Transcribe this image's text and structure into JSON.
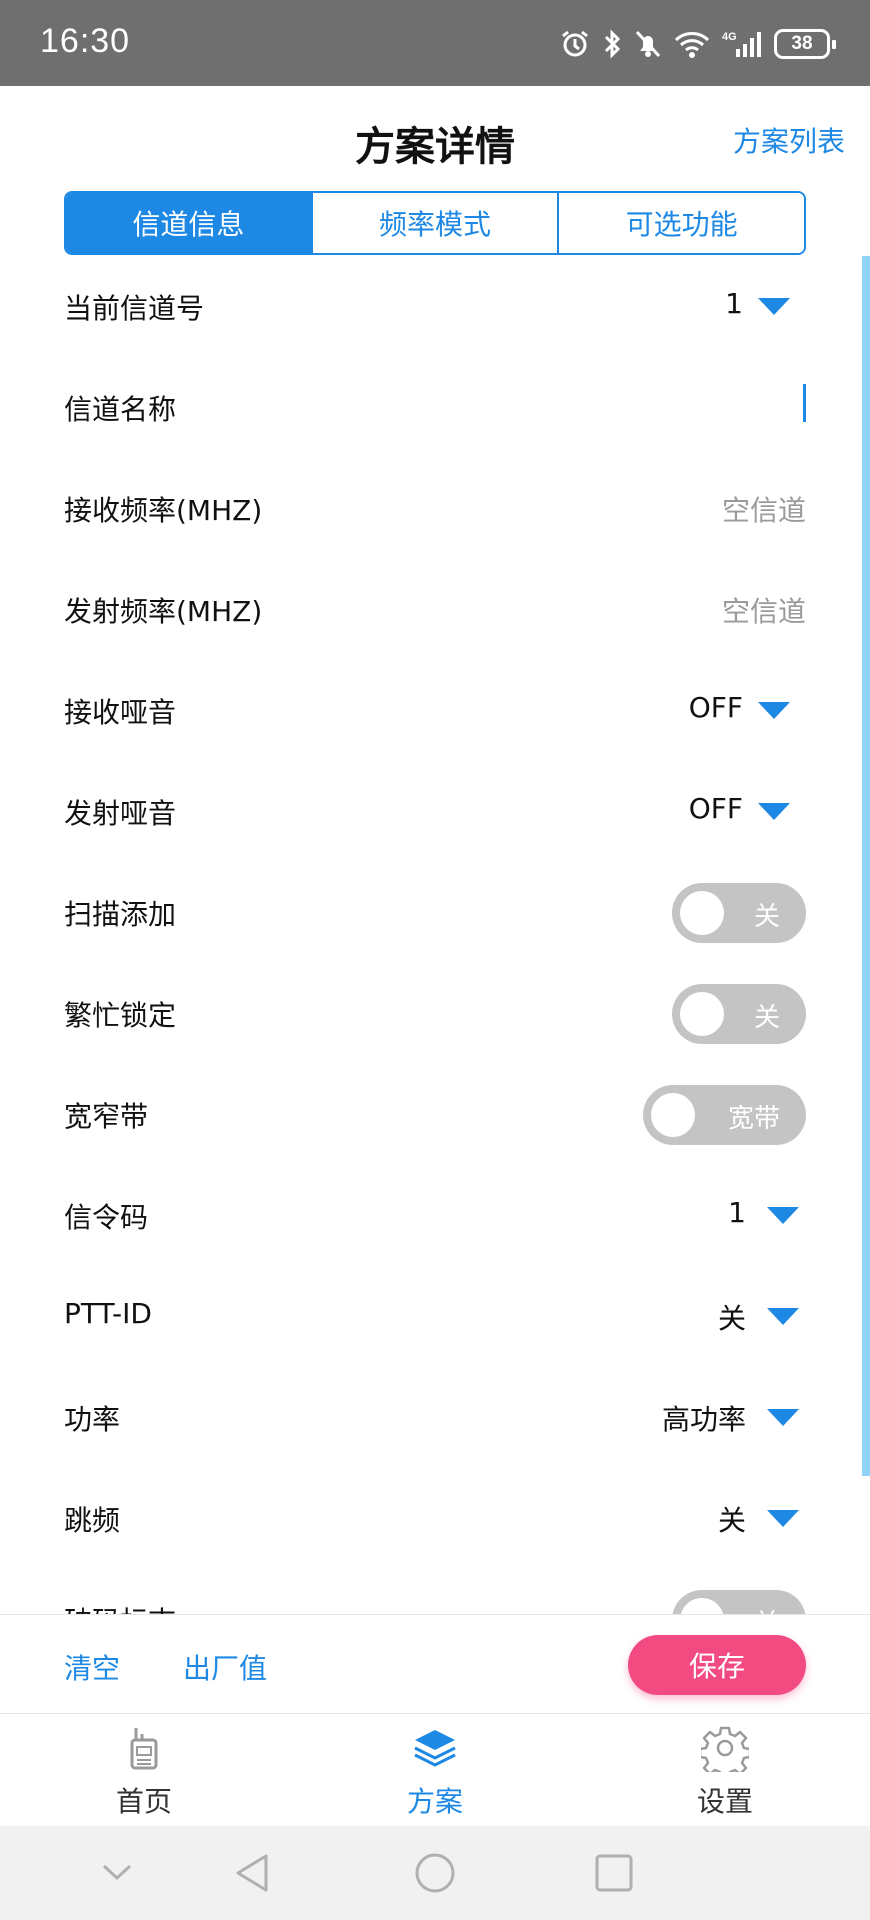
{
  "status_bar": {
    "time": "16:30",
    "battery": "38"
  },
  "header": {
    "title": "方案详情",
    "plan_list": "方案列表"
  },
  "tabs": [
    {
      "label": "信道信息",
      "active": true
    },
    {
      "label": "频率模式",
      "active": false
    },
    {
      "label": "可选功能",
      "active": false
    }
  ],
  "rows": {
    "channel_no": {
      "label": "当前信道号",
      "value": "1"
    },
    "channel_name": {
      "label": "信道名称",
      "value": ""
    },
    "rx_freq": {
      "label": "接收频率(MHZ)",
      "placeholder": "空信道"
    },
    "tx_freq": {
      "label": "发射频率(MHZ)",
      "placeholder": "空信道"
    },
    "rx_squelch": {
      "label": "接收哑音",
      "value": "OFF"
    },
    "tx_squelch": {
      "label": "发射哑音",
      "value": "OFF"
    },
    "scan_add": {
      "label": "扫描添加",
      "toggle": "关"
    },
    "busy_lock": {
      "label": "繁忙锁定",
      "toggle": "关"
    },
    "bandwidth": {
      "label": "宽窄带",
      "toggle": "宽带"
    },
    "signal_code": {
      "label": "信令码",
      "value": "1"
    },
    "ptt_id": {
      "label": "PTT-ID",
      "value": "关"
    },
    "power": {
      "label": "功率",
      "value": "高功率"
    },
    "freq_hop": {
      "label": "跳频",
      "value": "关"
    },
    "scramble": {
      "label": "破码标志",
      "toggle": "关"
    }
  },
  "actions": {
    "clear": "清空",
    "factory": "出厂值",
    "save": "保存"
  },
  "bottom_nav": [
    {
      "label": "首页",
      "icon": "radio-icon",
      "active": false
    },
    {
      "label": "方案",
      "icon": "layers-icon",
      "active": true
    },
    {
      "label": "设置",
      "icon": "gear-icon",
      "active": false
    }
  ],
  "colors": {
    "accent": "#1e88e5",
    "save": "#f24b82",
    "toggle_off": "#c4c4c4",
    "status_bar": "#6f6f6f"
  }
}
